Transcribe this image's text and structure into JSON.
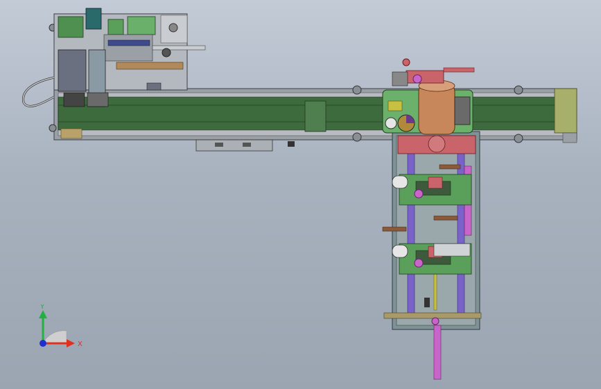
{
  "triad": {
    "x_label": "X",
    "y_label": "Y",
    "x_color": "#e0301e",
    "y_color": "#22b040",
    "z_color": "#2030d0"
  },
  "colors": {
    "background_top": "#c3cbd6",
    "background_bottom": "#9ba5b2",
    "rail_green": "#3e6b3e",
    "frame_grey": "#8a8f96",
    "copper": "#c8875a",
    "purple_rod": "#7a63c8",
    "magenta_rod": "#c865c8",
    "salmon": "#c8646a",
    "board_green": "#5aa05a"
  }
}
